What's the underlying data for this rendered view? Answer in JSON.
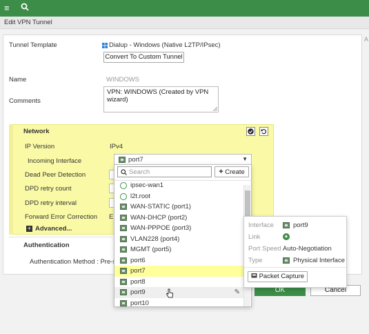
{
  "topbar": {
    "menu_icon": "≡",
    "search_icon": "search-icon"
  },
  "page_title": "Edit VPN Tunnel",
  "form": {
    "tunnel_template_label": "Tunnel Template",
    "tunnel_template_value": "Dialup - Windows (Native L2TP/IPsec)",
    "convert_button": "Convert To Custom Tunnel",
    "name_label": "Name",
    "name_value": "WINDOWS",
    "comments_label": "Comments",
    "comments_line1": "VPN: WINDOWS (Created by VPN",
    "comments_line2": "wizard)"
  },
  "network": {
    "title": "Network",
    "ip_version_label": "IP Version",
    "ip_version_value": "IPv4",
    "incoming_interface_label": "Incoming Interface",
    "incoming_interface_value": "port7",
    "dead_peer_label": "Dead Peer Detection",
    "dpd_retry_count_label": "DPD retry count",
    "dpd_retry_interval_label": "DPD retry interval",
    "fec_label": "Forward Error Correction",
    "fec_value_partial": "E",
    "advanced_label": "Advanced..."
  },
  "authentication": {
    "title": "Authentication",
    "method_label": "Authentication Method : Pre-s"
  },
  "dropdown": {
    "search_placeholder": "Search",
    "create_label": "Create",
    "items": [
      {
        "label": "ipsec-wan1",
        "type": "tunnel"
      },
      {
        "label": "l2t.root",
        "type": "tunnel"
      },
      {
        "label": "WAN-STATIC (port1)",
        "type": "port"
      },
      {
        "label": "WAN-DHCP (port2)",
        "type": "port"
      },
      {
        "label": "WAN-PPPOE (port3)",
        "type": "port"
      },
      {
        "label": "VLAN228 (port4)",
        "type": "port"
      },
      {
        "label": "MGMT (port5)",
        "type": "port"
      },
      {
        "label": "port6",
        "type": "port"
      },
      {
        "label": "port7",
        "type": "port"
      },
      {
        "label": "port8",
        "type": "port"
      },
      {
        "label": "port9",
        "type": "port"
      },
      {
        "label": "port10",
        "type": "port"
      }
    ],
    "selected": "port7",
    "hovered": "port9"
  },
  "info_panel": {
    "interface_label": "Interface",
    "interface_value": "port9",
    "link_label": "Link",
    "port_speed_label": "Port Speed",
    "port_speed_value": "Auto-Negotiation",
    "type_label": "Type",
    "type_value": "Physical Interface",
    "packet_capture_label": "Packet Capture"
  },
  "footer": {
    "ok_label": "OK",
    "cancel_label": "Cancel"
  },
  "side_text": "A",
  "colors": {
    "accent_green": "#3b8d47",
    "network_bg": "#fafaa6",
    "selected_row": "#ffff9c"
  }
}
